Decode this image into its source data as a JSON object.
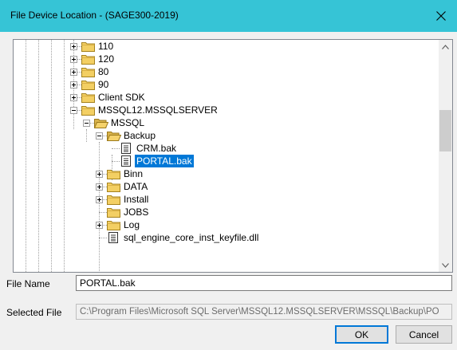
{
  "window": {
    "title": "File Device Location - (SAGE300-2019)"
  },
  "tree": {
    "items": [
      {
        "label": "110",
        "type": "folder",
        "expander": "plus"
      },
      {
        "label": "120",
        "type": "folder",
        "expander": "plus"
      },
      {
        "label": "80",
        "type": "folder",
        "expander": "plus"
      },
      {
        "label": "90",
        "type": "folder",
        "expander": "plus"
      },
      {
        "label": "Client SDK",
        "type": "folder",
        "expander": "plus"
      },
      {
        "label": "MSSQL12.MSSQLSERVER",
        "type": "folder",
        "expander": "minus"
      },
      {
        "label": "MSSQL",
        "type": "folder-open",
        "expander": "minus"
      },
      {
        "label": "Backup",
        "type": "folder-open",
        "expander": "minus"
      },
      {
        "label": "CRM.bak",
        "type": "file",
        "expander": "none"
      },
      {
        "label": "PORTAL.bak",
        "type": "file",
        "expander": "none",
        "selected": true
      },
      {
        "label": "Binn",
        "type": "folder",
        "expander": "plus"
      },
      {
        "label": "DATA",
        "type": "folder",
        "expander": "plus"
      },
      {
        "label": "Install",
        "type": "folder",
        "expander": "plus"
      },
      {
        "label": "JOBS",
        "type": "folder",
        "expander": "none"
      },
      {
        "label": "Log",
        "type": "folder",
        "expander": "plus"
      },
      {
        "label": "sql_engine_core_inst_keyfile.dll",
        "type": "file",
        "expander": "none"
      }
    ]
  },
  "form": {
    "file_name_label": "File Name",
    "file_name_value": "PORTAL.bak",
    "selected_file_label": "Selected File",
    "selected_file_value": "C:\\Program Files\\Microsoft SQL Server\\MSSQL12.MSSQLSERVER\\MSSQL\\Backup\\PO"
  },
  "buttons": {
    "ok": "OK",
    "cancel": "Cancel"
  },
  "colors": {
    "titlebar": "#36c4d6",
    "selection": "#0078d7"
  }
}
